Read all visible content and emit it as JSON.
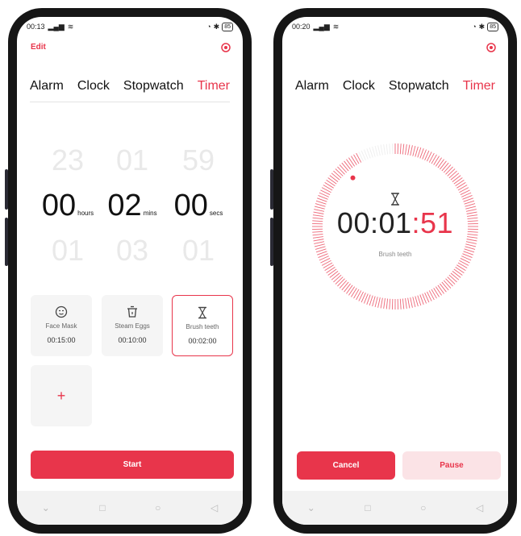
{
  "left": {
    "status": {
      "time": "00:13",
      "battery": "85"
    },
    "edit_label": "Edit",
    "tabs": [
      "Alarm",
      "Clock",
      "Stopwatch",
      "Timer"
    ],
    "active_tab": "Timer",
    "picker": {
      "hours": {
        "prev": "23",
        "current": "00",
        "next": "01",
        "unit": "hours"
      },
      "mins": {
        "prev": "01",
        "current": "02",
        "next": "03",
        "unit": "mins"
      },
      "secs": {
        "prev": "59",
        "current": "00",
        "next": "01",
        "unit": "secs"
      }
    },
    "presets": [
      {
        "name": "Face Mask",
        "duration": "00:15:00",
        "icon": "face-mask-icon"
      },
      {
        "name": "Steam Eggs",
        "duration": "00:10:00",
        "icon": "steam-eggs-icon"
      },
      {
        "name": "Brush teeth",
        "duration": "00:02:00",
        "icon": "hourglass-icon",
        "selected": true
      }
    ],
    "add_label": "+",
    "start_label": "Start"
  },
  "right": {
    "status": {
      "time": "00:20",
      "battery": "85"
    },
    "tabs": [
      "Alarm",
      "Clock",
      "Stopwatch",
      "Timer"
    ],
    "active_tab": "Timer",
    "countdown": {
      "hm": "00:01",
      "sep": ":",
      "sec": "51"
    },
    "remaining_fraction": 0.925,
    "label": "Brush teeth",
    "cancel_label": "Cancel",
    "pause_label": "Pause"
  },
  "colors": {
    "accent": "#e8354b",
    "accent_light": "#fbe3e6",
    "ring_track": "#eeeeee"
  }
}
